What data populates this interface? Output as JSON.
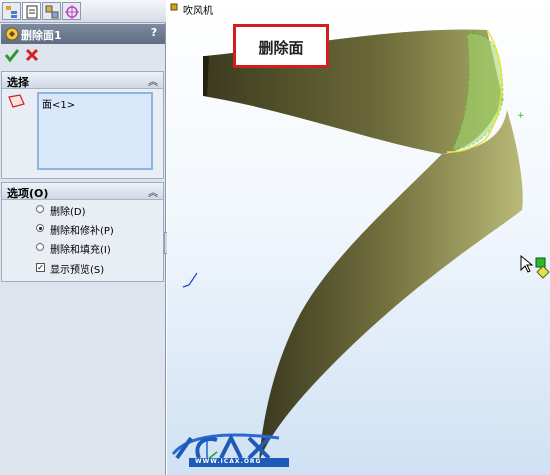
{
  "tabs": [
    {
      "name": "feature-manager"
    },
    {
      "name": "property-manager"
    },
    {
      "name": "configuration-manager"
    },
    {
      "name": "dimxpert-manager"
    }
  ],
  "property_manager": {
    "title": "删除面1",
    "help": "?",
    "ok": "✔",
    "cancel": "✖"
  },
  "selection_group": {
    "title": "选择",
    "collapse": "︽",
    "items": [
      "面<1>"
    ]
  },
  "options_group": {
    "title": "选项(O)",
    "collapse": "︽",
    "options": [
      {
        "label": "删除(D)",
        "selected": false
      },
      {
        "label": "删除和修补(P)",
        "selected": true
      },
      {
        "label": "删除和填充(I)",
        "selected": false
      }
    ],
    "show_preview": {
      "label": "显示预览(S)",
      "checked": true,
      "mark": "✓"
    }
  },
  "viewport": {
    "tree_label": "吹风机",
    "callout": "删除面",
    "logo_text": "WWW.ICAX.ORG",
    "colors": {
      "callout_border": "#d21e1e",
      "surface": "#6a6a3a",
      "highlight": "#7fd63a"
    }
  }
}
